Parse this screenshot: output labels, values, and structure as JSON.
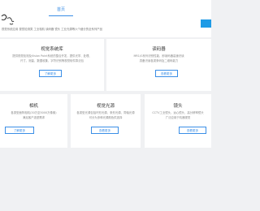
{
  "header": {
    "nav_home": "首页",
    "product_line": "视觉系统应用  视觉检测类  工业相机  读码器  镜头  工业光源等六个细分的全系列产品"
  },
  "cards": [
    {
      "title": "视觉系统库",
      "desc_line1": "提供视觉检测及Vision Point系统的整合开发，提供光学、处理、",
      "desc_line2": "尺寸、测量、数据收集、字符识别等视觉软件算法包",
      "button": "了解更多"
    },
    {
      "title": "读码器",
      "desc_line1": "MR1/G系列识别性能、即读码器高速识读",
      "desc_line2": "具备识读各类条码及二维码能力",
      "button": "查看更多"
    },
    {
      "title": "相机",
      "desc_line1": "各类型面阵相机(30万至5000万像素)",
      "desc_line2": "满足客户选型需求",
      "button": "了解更多"
    },
    {
      "title": "视觉光源",
      "desc_line1": "各类型光源包括环形光源、条形光源、同轴光源",
      "desc_line2": "可分为多种光源颜色供选择",
      "button": "查看更多"
    },
    {
      "title": "镜头",
      "desc_line1": "CCTV工业镜头、远心镜头、高分辨率镜头",
      "desc_line2": "广泛应用于机器视觉",
      "button": "查看更多"
    }
  ]
}
